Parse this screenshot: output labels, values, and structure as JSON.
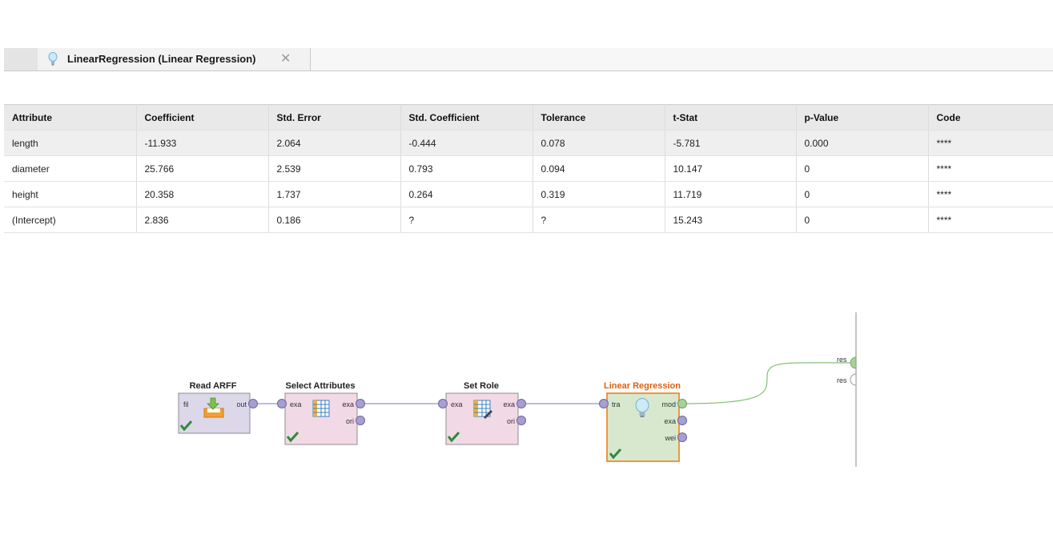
{
  "tab": {
    "title": "LinearRegression (Linear Regression)",
    "icon": "lightbulb-icon",
    "close_icon": "close-icon",
    "close_symbol": "✕"
  },
  "table": {
    "columns": [
      "Attribute",
      "Coefficient",
      "Std. Error",
      "Std. Coefficient",
      "Tolerance",
      "t-Stat",
      "p-Value",
      "Code"
    ],
    "rows": [
      [
        "length",
        "-11.933",
        "2.064",
        "-0.444",
        "0.078",
        "-5.781",
        "0.000",
        "****"
      ],
      [
        "diameter",
        "25.766",
        "2.539",
        "0.793",
        "0.094",
        "10.147",
        "0",
        "****"
      ],
      [
        "height",
        "20.358",
        "1.737",
        "0.264",
        "0.319",
        "11.719",
        "0",
        "****"
      ],
      [
        "(Intercept)",
        "2.836",
        "0.186",
        "?",
        "?",
        "15.243",
        "0",
        "****"
      ]
    ],
    "selected_row": 0
  },
  "process": {
    "operators": [
      {
        "name": "Read ARFF",
        "inputs": [
          "fil"
        ],
        "outputs": [
          "out"
        ],
        "icon": "download-tray-icon",
        "color": "#dcd8ea",
        "status": "check-icon"
      },
      {
        "name": "Select Attributes",
        "inputs": [
          "exa"
        ],
        "outputs": [
          "exa",
          "ori"
        ],
        "icon": "table-icon",
        "color": "#f1d9e6",
        "status": "check-icon"
      },
      {
        "name": "Set Role",
        "inputs": [
          "exa"
        ],
        "outputs": [
          "exa",
          "ori"
        ],
        "icon": "table-edit-icon",
        "color": "#f1d9e6",
        "status": "check-icon"
      },
      {
        "name": "Linear Regression",
        "inputs": [
          "tra"
        ],
        "outputs": [
          "mod",
          "exa",
          "wei"
        ],
        "icon": "lightbulb-icon",
        "color": "#d7e8cf",
        "status": "check-icon",
        "selected": true,
        "title_color": "#e06010"
      }
    ],
    "result_ports": [
      "res",
      "res"
    ]
  }
}
